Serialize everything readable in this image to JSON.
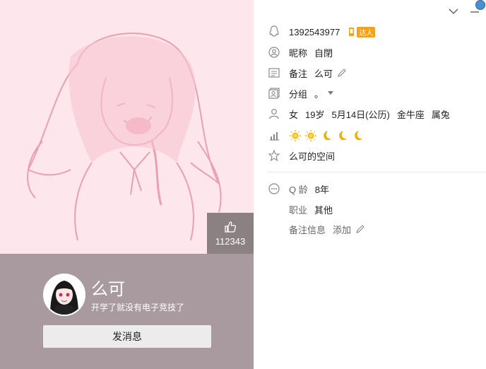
{
  "profile": {
    "likes": "112343",
    "nickname": "么可",
    "signature": "开学了就没有电子竞技了",
    "message_button": "发消息"
  },
  "info": {
    "qq_number": "1392543977",
    "badge": "达人",
    "nickname_label": "昵称",
    "nickname_value": "自閉",
    "remark_label": "备注",
    "remark_value": "么可",
    "group_label": "分组",
    "group_value": "。",
    "gender": "女",
    "age": "19岁",
    "birthday": "5月14日(公历)",
    "zodiac": "金牛座",
    "chinese_zodiac": "属兔",
    "level_icons": [
      "sun",
      "sun",
      "moon",
      "moon",
      "moon"
    ],
    "space_link": "么可的空间",
    "q_age_label": "Q 龄",
    "q_age_value": "8年",
    "job_label": "职业",
    "job_value": "其他",
    "remark_info_label": "备注信息",
    "remark_info_add": "添加"
  },
  "colors": {
    "left_bottom_bg": "#a89a9e",
    "art_bg": "#fde6ec",
    "sun": "#f5b400",
    "moon": "#f0b000"
  }
}
